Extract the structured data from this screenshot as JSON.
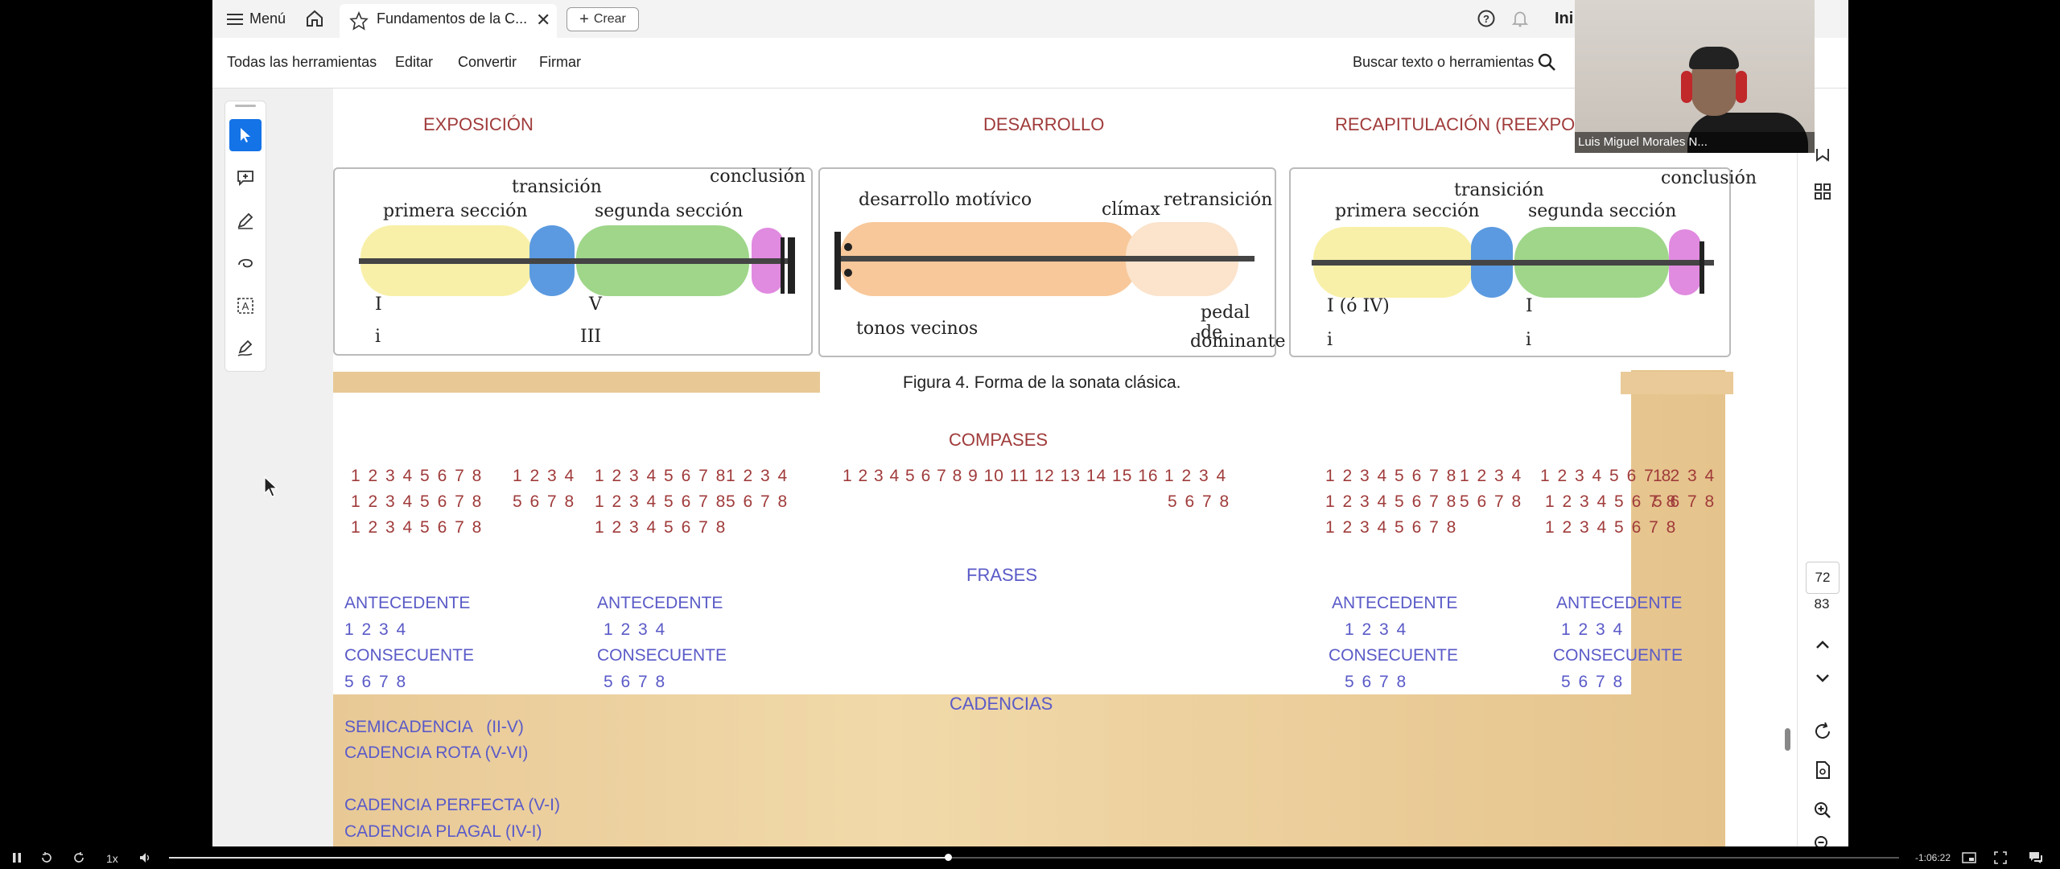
{
  "tabbar": {
    "menu_label": "Menú",
    "tab_title": "Fundamentos de la C...",
    "create_label": "Crear",
    "right_label": "Ini"
  },
  "toolbar": {
    "all_tools": "Todas las herramientas",
    "edit": "Editar",
    "convert": "Convertir",
    "sign": "Firmar",
    "search": "Buscar texto o herramientas"
  },
  "sections": {
    "exposition": "EXPOSICIÓN",
    "development": "DESARROLLO",
    "recap": "RECAPITULACIÓN (REEXPOSICIÓN)"
  },
  "diagram": {
    "d1": {
      "transition": "transición",
      "conclusion": "conclusión",
      "first": "primera sección",
      "second": "segunda sección",
      "i_upper": "I",
      "i_lower": "i",
      "v": "V",
      "iii": "III"
    },
    "d2": {
      "motif": "desarrollo motívico",
      "climax": "clímax",
      "retrans": "retransición",
      "tonos": "tonos vecinos",
      "pedal1": "pedal de",
      "pedal2": "dominante"
    },
    "d3": {
      "transition": "transición",
      "conclusion": "conclusión",
      "first": "primera sección",
      "second": "segunda sección",
      "i_iv": "I (ó IV)",
      "i_upper": "I",
      "i_lower1": "i",
      "i_lower2": "i"
    }
  },
  "figure_caption": "Figura 4. Forma de la sonata clásica.",
  "compases": {
    "title": "COMPASES",
    "c1": [
      "1 2 3 4 5 6 7 8",
      "1 2 3 4 5 6 7 8",
      "1 2 3 4 5 6 7 8"
    ],
    "c2": [
      "1 2 3 4",
      "5 6 7 8"
    ],
    "c3": [
      "1 2 3 4 5 6 7 8",
      "1 2 3 4 5 6 7 8",
      "1 2 3 4 5 6 7 8"
    ],
    "c4": [
      "1 2 3 4",
      "5 6 7 8"
    ],
    "c5": [
      "1 2 3 4 5 6 7 8 9 10 11 12 13 14 15 16"
    ],
    "c6": [
      "1 2 3 4",
      "5 6 7 8"
    ],
    "c7": [
      "1 2 3 4 5 6 7 8",
      "1 2 3 4 5 6 7 8",
      "1 2 3 4 5 6 7 8"
    ],
    "c8": [
      "1 2 3 4",
      "5 6 7 8"
    ],
    "c9": [
      "1 2 3 4 5 6 7 8",
      "1 2 3 4 5 6 7 8",
      "1 2 3 4 5 6 7 8"
    ],
    "c10": [
      "1 2 3 4",
      "5 6 7 8"
    ]
  },
  "frases": {
    "title": "FRASES",
    "antecedente": "ANTECEDENTE",
    "consecuente": "CONSECUENTE",
    "n1": "1 2 3 4",
    "n2": "5 6 7 8"
  },
  "cadencias": {
    "title": "CADENCIAS",
    "items": [
      "SEMICADENCIA   (II-V)",
      "CADENCIA ROTA (V-VI)",
      "CADENCIA PERFECTA (V-I)",
      "CADENCIA PLAGAL (IV-I)"
    ]
  },
  "pages": {
    "current": "72",
    "total": "83"
  },
  "webcam": {
    "name": "Luis Miguel Morales N..."
  },
  "player": {
    "speed": "1x",
    "time": "-1:06:22",
    "progress": 0.45
  },
  "colors": {
    "accent": "#1473e6",
    "red_text": "#a03b3b",
    "blue_text": "#5a5ac8"
  }
}
